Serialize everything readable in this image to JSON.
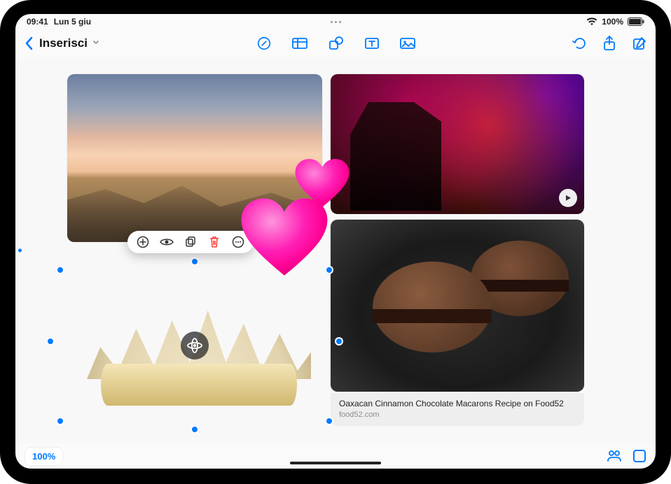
{
  "status": {
    "time": "09:41",
    "date": "Lun 5 giu",
    "battery": "100%"
  },
  "toolbar": {
    "title": "Inserisci"
  },
  "editMenu": {
    "items": [
      "add",
      "look",
      "copy",
      "delete",
      "more"
    ]
  },
  "linkCard": {
    "title": "Oaxacan Cinnamon Chocolate Macarons Recipe on Food52",
    "domain": "food52.com"
  },
  "bottom": {
    "zoom": "100%"
  },
  "stickers": {
    "heart1": "❤️",
    "heart2": "❤️"
  }
}
